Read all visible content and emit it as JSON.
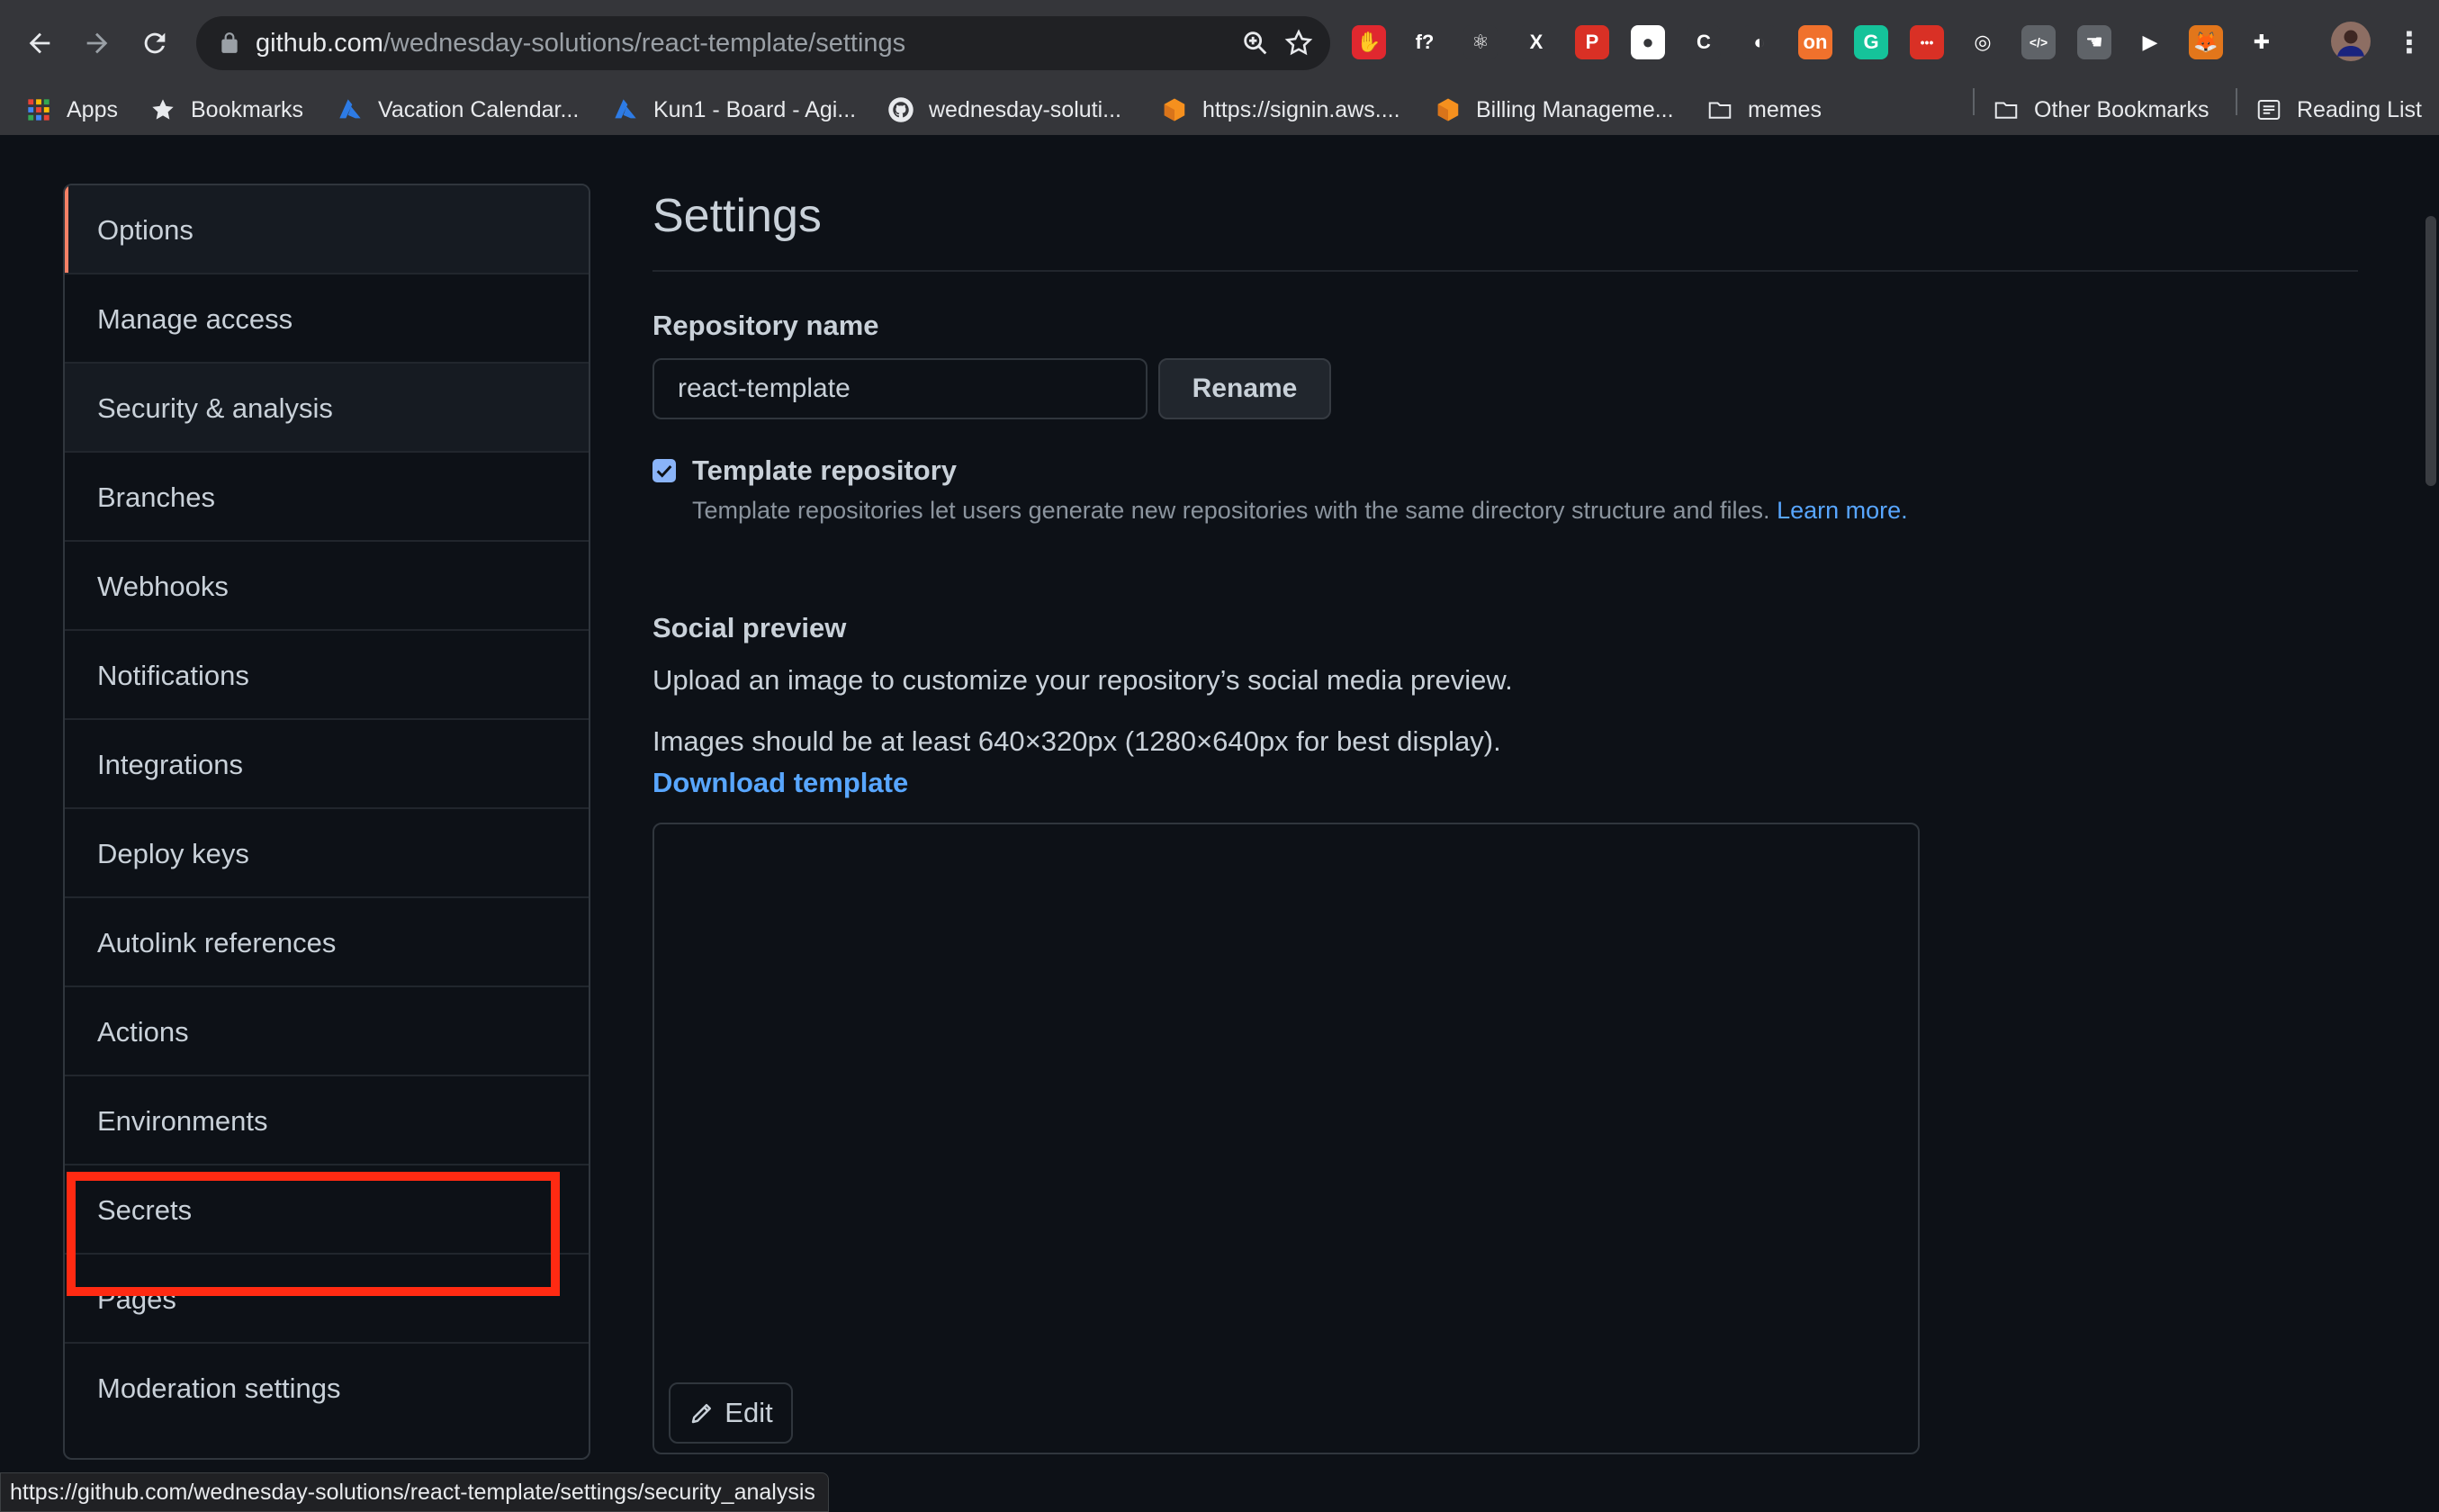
{
  "browser": {
    "url_host": "github.com",
    "url_path": "/wednesday-solutions/react-template/settings",
    "extensions": [
      {
        "name": "adblock-icon",
        "color": "#e0282f",
        "glyph": "✋"
      },
      {
        "name": "formula-icon",
        "color": "#35363a",
        "glyph": "f?"
      },
      {
        "name": "react-devtools-icon",
        "color": "#35363a",
        "glyph": "⚛"
      },
      {
        "name": "x-extension-icon",
        "color": "#35363a",
        "glyph": "X"
      },
      {
        "name": "pdf-extension-icon",
        "color": "#d93025",
        "glyph": "P"
      },
      {
        "name": "circle-extension-icon",
        "color": "#ffffff",
        "glyph": "●"
      },
      {
        "name": "c-extension-icon",
        "color": "#35363a",
        "glyph": "C"
      },
      {
        "name": "translate-extension-icon",
        "color": "#35363a",
        "glyph": "◐"
      },
      {
        "name": "toggle-extension-icon",
        "color": "#f0712c",
        "glyph": "on"
      },
      {
        "name": "grammarly-icon",
        "color": "#15c39a",
        "glyph": "G"
      },
      {
        "name": "dots-extension-icon",
        "color": "#d93025",
        "glyph": "•••"
      },
      {
        "name": "target-extension-icon",
        "color": "#35363a",
        "glyph": "◎"
      },
      {
        "name": "code-extension-icon",
        "color": "#5f6368",
        "glyph": "</>"
      },
      {
        "name": "hand-extension-icon",
        "color": "#5f6368",
        "glyph": "☚"
      },
      {
        "name": "play-extension-icon",
        "color": "#35363a",
        "glyph": "▶"
      },
      {
        "name": "metamask-icon",
        "color": "#e2761b",
        "glyph": "🦊"
      },
      {
        "name": "puzzle-icon",
        "color": "#35363a",
        "glyph": "✚"
      }
    ],
    "bookmarks": [
      {
        "label": "Apps",
        "icon": "apps-grid-icon"
      },
      {
        "label": "Bookmarks",
        "icon": "star-icon"
      },
      {
        "label": "Vacation Calendar...",
        "icon": "azure-icon"
      },
      {
        "label": "Kun1 - Board - Agi...",
        "icon": "azure-icon"
      },
      {
        "label": "wednesday-soluti...",
        "icon": "github-icon"
      },
      {
        "label": "https://signin.aws....",
        "icon": "aws-icon"
      },
      {
        "label": "Billing Manageme...",
        "icon": "aws-icon"
      },
      {
        "label": "memes",
        "icon": "folder-icon"
      },
      {
        "label": "Other Bookmarks",
        "icon": "folder-icon"
      },
      {
        "label": "Reading List",
        "icon": "reading-list-icon"
      }
    ]
  },
  "sidebar": {
    "items": [
      {
        "label": "Options"
      },
      {
        "label": "Manage access"
      },
      {
        "label": "Security & analysis"
      },
      {
        "label": "Branches"
      },
      {
        "label": "Webhooks"
      },
      {
        "label": "Notifications"
      },
      {
        "label": "Integrations"
      },
      {
        "label": "Deploy keys"
      },
      {
        "label": "Autolink references"
      },
      {
        "label": "Actions"
      },
      {
        "label": "Environments"
      },
      {
        "label": "Secrets"
      },
      {
        "label": "Pages"
      },
      {
        "label": "Moderation settings"
      }
    ],
    "selected": "Options",
    "highlighted": "Secrets"
  },
  "main": {
    "title": "Settings",
    "repo_name_label": "Repository name",
    "repo_name_value": "react-template",
    "rename_label": "Rename",
    "template_repo_label": "Template repository",
    "template_repo_checked": true,
    "template_repo_note": "Template repositories let users generate new repositories with the same directory structure and files.",
    "learn_more": "Learn more.",
    "social_preview_label": "Social preview",
    "social_preview_desc": "Upload an image to customize your repository’s social media preview.",
    "social_preview_size": "Images should be at least 640×320px (1280×640px for best display).",
    "download_template": "Download template",
    "edit_label": "Edit"
  },
  "status_bar_url": "https://github.com/wednesday-solutions/react-template/settings/security_analysis",
  "colors": {
    "accent_selected": "#f78166",
    "link": "#58a6ff",
    "highlight_box": "#ff2a12",
    "page_bg": "#0d1117"
  }
}
